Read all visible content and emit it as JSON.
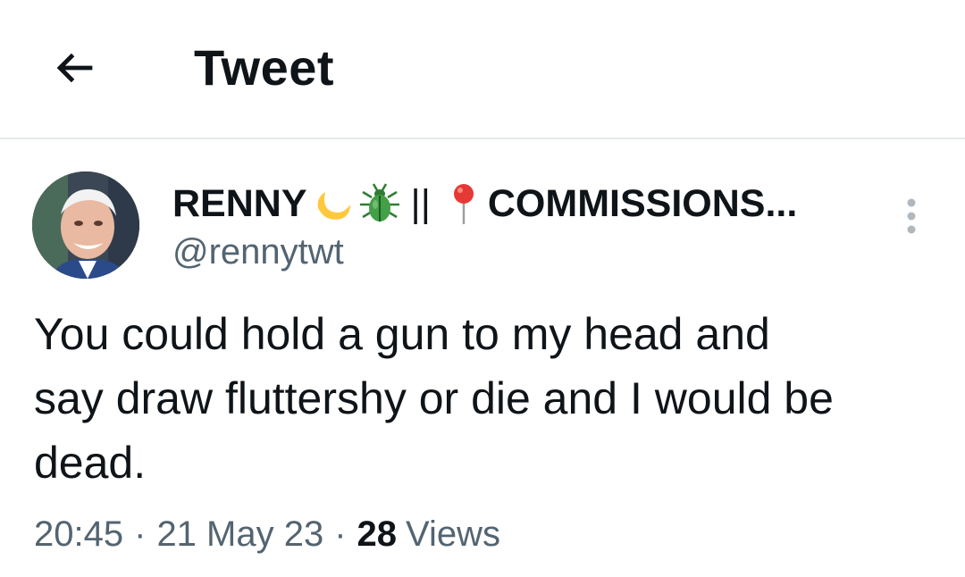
{
  "header": {
    "title": "Tweet",
    "back_icon": "arrow-left-icon"
  },
  "tweet": {
    "author": {
      "display_name_prefix": "RENNY",
      "name_emojis": [
        "crescent-moon-icon",
        "beetle-icon"
      ],
      "separator": "||",
      "pin_icon": "round-pushpin-icon",
      "display_name_suffix": "COMMISSIONS...",
      "handle": "@rennytwt",
      "avatar_icon": "avatar"
    },
    "more_icon": "more-vertical-icon",
    "text_lines": [
      "You could hold a gun to my head and",
      "say draw fluttershy or die and I would be",
      "dead."
    ],
    "time": "20:45",
    "date": "21 May 23",
    "separator_dot": "·",
    "views_count": "28",
    "views_label": "Views"
  },
  "colors": {
    "text_primary": "#0f1419",
    "text_secondary": "#536471",
    "divider": "#e6e9eb",
    "background": "#ffffff"
  }
}
